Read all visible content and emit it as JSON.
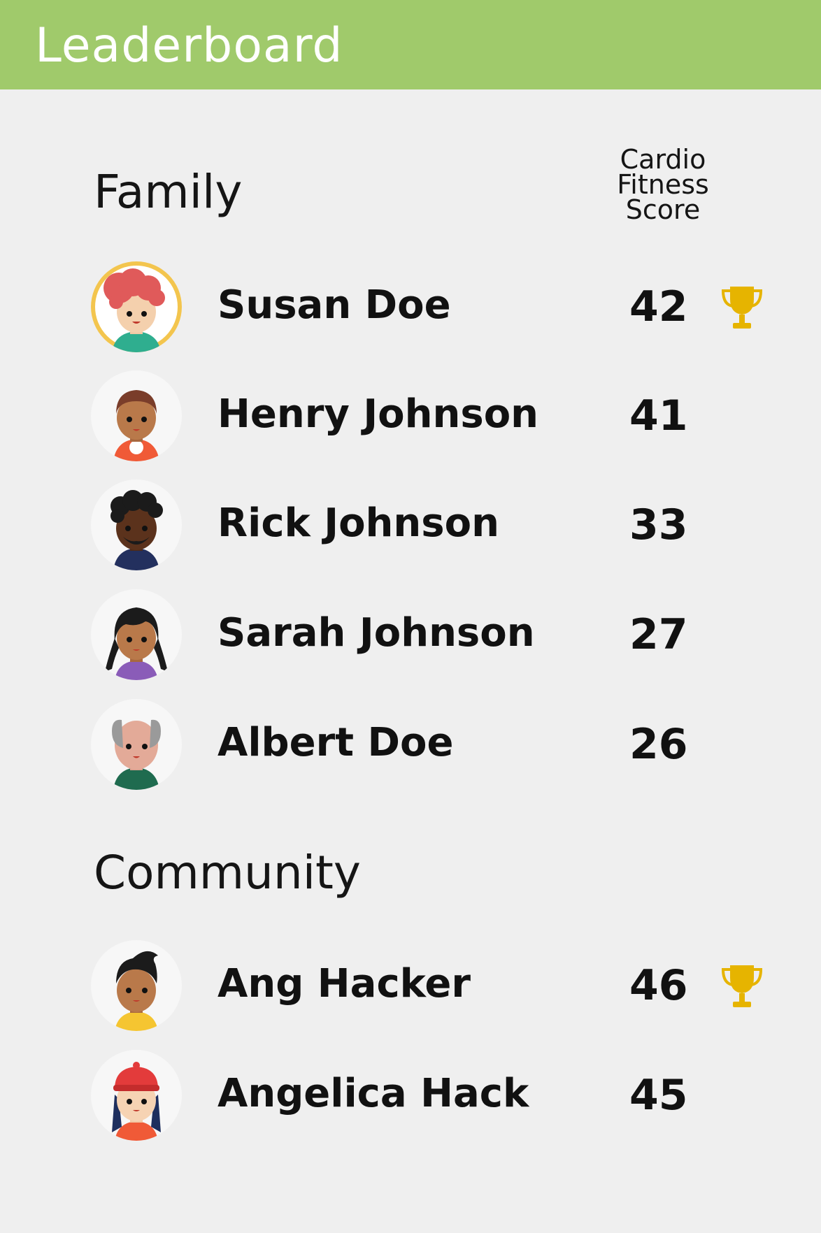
{
  "appbar": {
    "title": "Leaderboard"
  },
  "columns": {
    "score_header_line1": "Cardio",
    "score_header_line2": "Fitness",
    "score_header_line3": "Score"
  },
  "family": {
    "title": "Family",
    "members": [
      {
        "name": "Susan Doe",
        "score": "42",
        "avatar": "avatar-red-curly-hair-woman-icon",
        "leader": true
      },
      {
        "name": "Henry Johnson",
        "score": "41",
        "avatar": "avatar-brown-hair-man-icon",
        "leader": false
      },
      {
        "name": "Rick Johnson",
        "score": "33",
        "avatar": "avatar-afro-beard-man-icon",
        "leader": false
      },
      {
        "name": "Sarah Johnson",
        "score": "27",
        "avatar": "avatar-pigtails-girl-icon",
        "leader": false
      },
      {
        "name": "Albert Doe",
        "score": "26",
        "avatar": "avatar-bald-old-man-icon",
        "leader": false
      }
    ]
  },
  "community": {
    "title": "Community",
    "members": [
      {
        "name": "Ang Hacker",
        "score": "46",
        "avatar": "avatar-black-quiff-man-icon",
        "leader": true
      },
      {
        "name": "Angelica Hack",
        "score": "45",
        "avatar": "avatar-red-cap-woman-icon",
        "leader": false
      }
    ]
  },
  "colors": {
    "appbar": "#a0ca6b",
    "background": "#efefef",
    "trophy": "#e6b400",
    "highlight_ring": "#f3c54e"
  },
  "icons": {
    "trophy": "trophy-icon"
  }
}
